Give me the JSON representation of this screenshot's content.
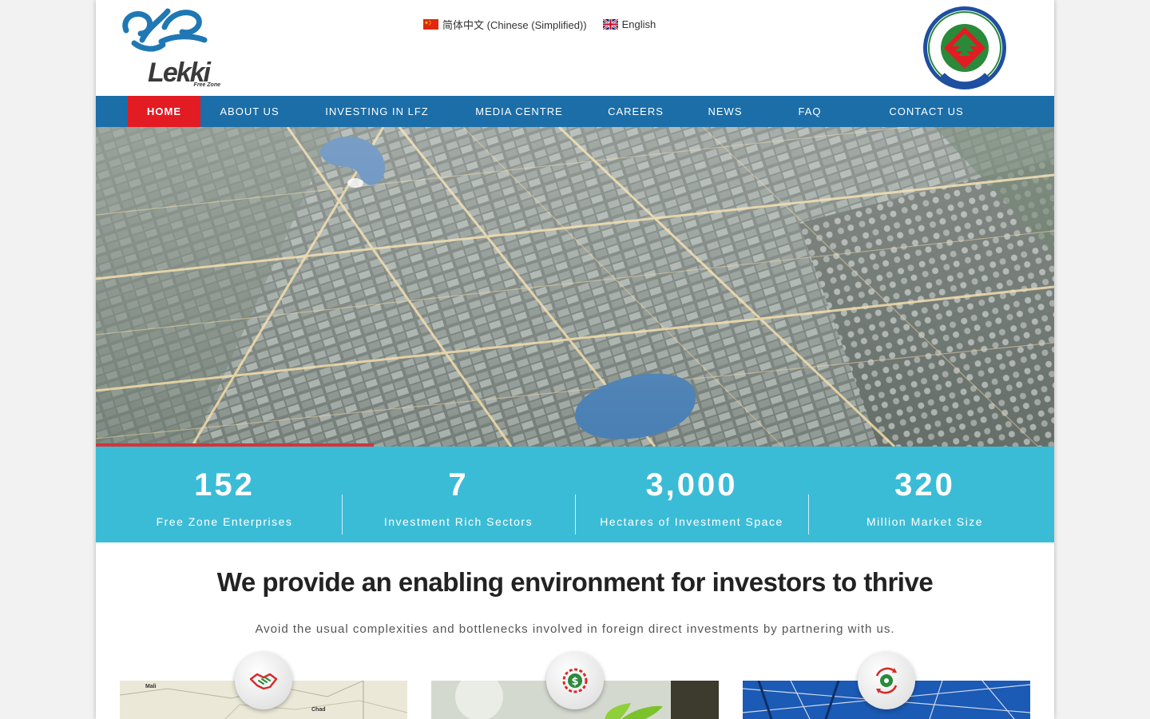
{
  "header": {
    "logo_text": "Lekki",
    "logo_subtext": "Free Zone",
    "languages": [
      {
        "label": "简体中文 (Chinese (Simplified))",
        "flag": "cn-flag-icon"
      },
      {
        "label": "English",
        "flag": "uk-flag-icon"
      }
    ]
  },
  "nav": {
    "items": [
      {
        "label": "HOME",
        "active": true
      },
      {
        "label": "ABOUT US"
      },
      {
        "label": "INVESTING IN LFZ"
      },
      {
        "label": "MEDIA CENTRE"
      },
      {
        "label": "CAREERS"
      },
      {
        "label": "NEWS"
      },
      {
        "label": "FAQ"
      },
      {
        "label": "CONTACT US"
      }
    ],
    "bg_color": "#1b6ea8",
    "active_color": "#e31b23"
  },
  "hero": {
    "slider_progress": 0.29
  },
  "stats": {
    "bg_color": "#3bbcd6",
    "items": [
      {
        "value": "152",
        "label": "Free Zone Enterprises"
      },
      {
        "value": "7",
        "label": "Investment Rich Sectors"
      },
      {
        "value": "3,000",
        "label": "Hectares of Investment Space"
      },
      {
        "value": "320",
        "label": "Million Market Size"
      }
    ]
  },
  "intro": {
    "title": "We provide an enabling environment for investors to thrive",
    "subtitle": "Avoid the usual complexities and bottlenecks involved in foreign direct investments by partnering with us."
  },
  "cards": [
    {
      "icon": "handshake-icon",
      "map_labels": [
        "Mali",
        "Chad"
      ]
    },
    {
      "icon": "dollar-gear-icon"
    },
    {
      "icon": "recycle-gear-icon"
    }
  ]
}
